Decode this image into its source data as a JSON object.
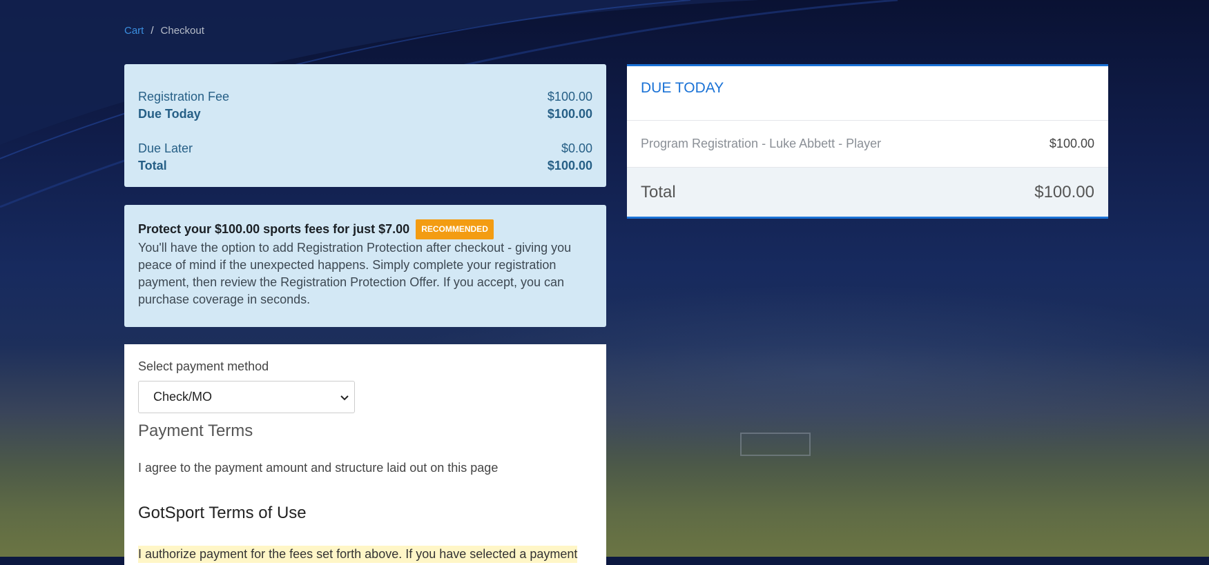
{
  "breadcrumb": {
    "cart": "Cart",
    "separator": "/",
    "current": "Checkout"
  },
  "summary": {
    "registration_fee_label": "Registration Fee",
    "registration_fee_value": "$100.00",
    "due_today_label": "Due Today",
    "due_today_value": "$100.00",
    "due_later_label": "Due Later",
    "due_later_value": "$0.00",
    "total_label": "Total",
    "total_value": "$100.00"
  },
  "protection": {
    "headline": "Protect your $100.00 sports fees for just $7.00",
    "badge": "RECOMMENDED",
    "body": "You'll have the option to add Registration Protection after checkout - giving you peace of mind if the unexpected happens. Simply complete your registration payment, then review the Registration Protection Offer. If you accept, you can purchase coverage in seconds."
  },
  "payment": {
    "select_label": "Select payment method",
    "selected_method": "Check/MO",
    "terms_heading": "Payment Terms",
    "terms_text": "I agree to the payment amount and structure laid out on this page",
    "gotsport_heading": "GotSport Terms of Use",
    "authorize_text": "I authorize payment for the fees set forth above. If you have selected a payment"
  },
  "due_card": {
    "title": "DUE TODAY",
    "item_label": "Program Registration - Luke Abbett - Player",
    "item_amount": "$100.00",
    "total_label": "Total",
    "total_value": "$100.00"
  },
  "colors": {
    "accent": "#1a72d6",
    "panel_blue": "#d3e8f5",
    "badge": "#f39c12"
  }
}
